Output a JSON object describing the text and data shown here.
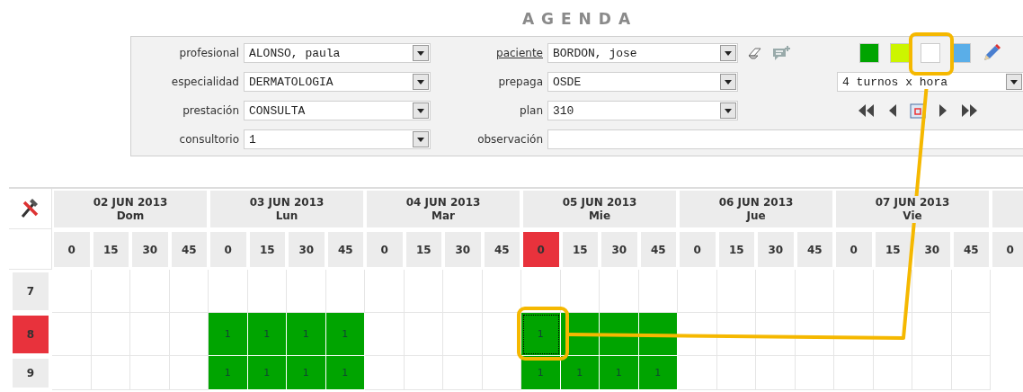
{
  "title": "AGENDA",
  "form": {
    "fields": [
      {
        "label": "profesional",
        "link": false,
        "kind": "dropdown",
        "value": "ALONSO, paula"
      },
      {
        "label": "paciente",
        "link": true,
        "kind": "dropdown",
        "value": "BORDON, jose"
      },
      {
        "label": "especialidad",
        "link": false,
        "kind": "dropdown",
        "value": "DERMATOLOGIA"
      },
      {
        "label": "prepaga",
        "link": false,
        "kind": "dropdown",
        "value": "OSDE"
      },
      {
        "label": "prestación",
        "link": false,
        "kind": "dropdown",
        "value": "CONSULTA"
      },
      {
        "label": "plan",
        "link": false,
        "kind": "dropdown",
        "value": "310"
      },
      {
        "label": "consultorio",
        "link": false,
        "kind": "dropdown",
        "value": "1"
      },
      {
        "label": "observación",
        "link": false,
        "kind": "text"
      }
    ],
    "swatches": [
      {
        "color": "#00a400"
      },
      {
        "color": "#ccf500"
      },
      {
        "color": "#ffffff"
      },
      {
        "color": "#5aaee8"
      }
    ],
    "slots_per_hour": "4 turnos x hora"
  },
  "grid": {
    "days": [
      {
        "date": "02 JUN 2013",
        "weekday": "Dom",
        "minutes": [
          {
            "label": "0",
            "selected": false
          },
          {
            "label": "15",
            "selected": false
          },
          {
            "label": "30",
            "selected": false
          },
          {
            "label": "45",
            "selected": false
          }
        ]
      },
      {
        "date": "03 JUN 2013",
        "weekday": "Lun",
        "minutes": [
          {
            "label": "0",
            "selected": false
          },
          {
            "label": "15",
            "selected": false
          },
          {
            "label": "30",
            "selected": false
          },
          {
            "label": "45",
            "selected": false
          }
        ]
      },
      {
        "date": "04 JUN 2013",
        "weekday": "Mar",
        "minutes": [
          {
            "label": "0",
            "selected": false
          },
          {
            "label": "15",
            "selected": false
          },
          {
            "label": "30",
            "selected": false
          },
          {
            "label": "45",
            "selected": false
          }
        ]
      },
      {
        "date": "05 JUN 2013",
        "weekday": "Mie",
        "minutes": [
          {
            "label": "0",
            "selected": true
          },
          {
            "label": "15",
            "selected": false
          },
          {
            "label": "30",
            "selected": false
          },
          {
            "label": "45",
            "selected": false
          }
        ]
      },
      {
        "date": "06 JUN 2013",
        "weekday": "Jue",
        "minutes": [
          {
            "label": "0",
            "selected": false
          },
          {
            "label": "15",
            "selected": false
          },
          {
            "label": "30",
            "selected": false
          },
          {
            "label": "45",
            "selected": false
          }
        ]
      },
      {
        "date": "07 JUN 2013",
        "weekday": "Vie",
        "minutes": [
          {
            "label": "0",
            "selected": false
          },
          {
            "label": "15",
            "selected": false
          },
          {
            "label": "30",
            "selected": false
          },
          {
            "label": "45",
            "selected": false
          }
        ]
      },
      {
        "minutes": [
          {
            "label": "0",
            "selected": false
          }
        ]
      }
    ],
    "rows": [
      {
        "hour": "7",
        "selected": false,
        "cells": [
          {
            "booked": false,
            "focused": false
          },
          {
            "booked": false,
            "focused": false
          },
          {
            "booked": false,
            "focused": false
          },
          {
            "booked": false,
            "focused": false
          },
          {
            "booked": false,
            "focused": false
          },
          {
            "booked": false,
            "focused": false
          },
          {
            "booked": false,
            "focused": false
          },
          {
            "booked": false,
            "focused": false
          },
          {
            "booked": false,
            "focused": false
          },
          {
            "booked": false,
            "focused": false
          },
          {
            "booked": false,
            "focused": false
          },
          {
            "booked": false,
            "focused": false
          },
          {
            "booked": false,
            "focused": false
          },
          {
            "booked": false,
            "focused": false
          },
          {
            "booked": false,
            "focused": false
          },
          {
            "booked": false,
            "focused": false
          },
          {
            "booked": false,
            "focused": false
          },
          {
            "booked": false,
            "focused": false
          },
          {
            "booked": false,
            "focused": false
          },
          {
            "booked": false,
            "focused": false
          },
          {
            "booked": false,
            "focused": false
          },
          {
            "booked": false,
            "focused": false
          },
          {
            "booked": false,
            "focused": false
          },
          {
            "booked": false,
            "focused": false
          }
        ]
      },
      {
        "hour": "8",
        "selected": true,
        "cells": [
          {
            "booked": false,
            "focused": false
          },
          {
            "booked": false,
            "focused": false
          },
          {
            "booked": false,
            "focused": false
          },
          {
            "booked": false,
            "focused": false
          },
          {
            "booked": true,
            "focused": false,
            "text": "1"
          },
          {
            "booked": true,
            "focused": false,
            "text": "1"
          },
          {
            "booked": true,
            "focused": false,
            "text": "1"
          },
          {
            "booked": true,
            "focused": false,
            "text": "1"
          },
          {
            "booked": false,
            "focused": false
          },
          {
            "booked": false,
            "focused": false
          },
          {
            "booked": false,
            "focused": false
          },
          {
            "booked": false,
            "focused": false
          },
          {
            "booked": true,
            "focused": true,
            "text": "1"
          },
          {
            "booked": true,
            "focused": false
          },
          {
            "booked": true,
            "focused": false
          },
          {
            "booked": true,
            "focused": false
          },
          {
            "booked": false,
            "focused": false
          },
          {
            "booked": false,
            "focused": false
          },
          {
            "booked": false,
            "focused": false
          },
          {
            "booked": false,
            "focused": false
          },
          {
            "booked": false,
            "focused": false
          },
          {
            "booked": false,
            "focused": false
          },
          {
            "booked": false,
            "focused": false
          },
          {
            "booked": false,
            "focused": false
          }
        ]
      },
      {
        "hour": "9",
        "selected": false,
        "cells": [
          {
            "booked": false,
            "focused": false
          },
          {
            "booked": false,
            "focused": false
          },
          {
            "booked": false,
            "focused": false
          },
          {
            "booked": false,
            "focused": false
          },
          {
            "booked": true,
            "focused": false,
            "text": "1"
          },
          {
            "booked": true,
            "focused": false,
            "text": "1"
          },
          {
            "booked": true,
            "focused": false,
            "text": "1"
          },
          {
            "booked": true,
            "focused": false,
            "text": "1"
          },
          {
            "booked": false,
            "focused": false
          },
          {
            "booked": false,
            "focused": false
          },
          {
            "booked": false,
            "focused": false
          },
          {
            "booked": false,
            "focused": false
          },
          {
            "booked": true,
            "focused": false,
            "text": "1"
          },
          {
            "booked": true,
            "focused": false,
            "text": "1"
          },
          {
            "booked": true,
            "focused": false,
            "text": "1"
          },
          {
            "booked": true,
            "focused": false,
            "text": "1"
          },
          {
            "booked": false,
            "focused": false
          },
          {
            "booked": false,
            "focused": false
          },
          {
            "booked": false,
            "focused": false
          },
          {
            "booked": false,
            "focused": false
          },
          {
            "booked": false,
            "focused": false
          },
          {
            "booked": false,
            "focused": false
          },
          {
            "booked": false,
            "focused": false
          },
          {
            "booked": false,
            "focused": false
          }
        ]
      }
    ]
  }
}
